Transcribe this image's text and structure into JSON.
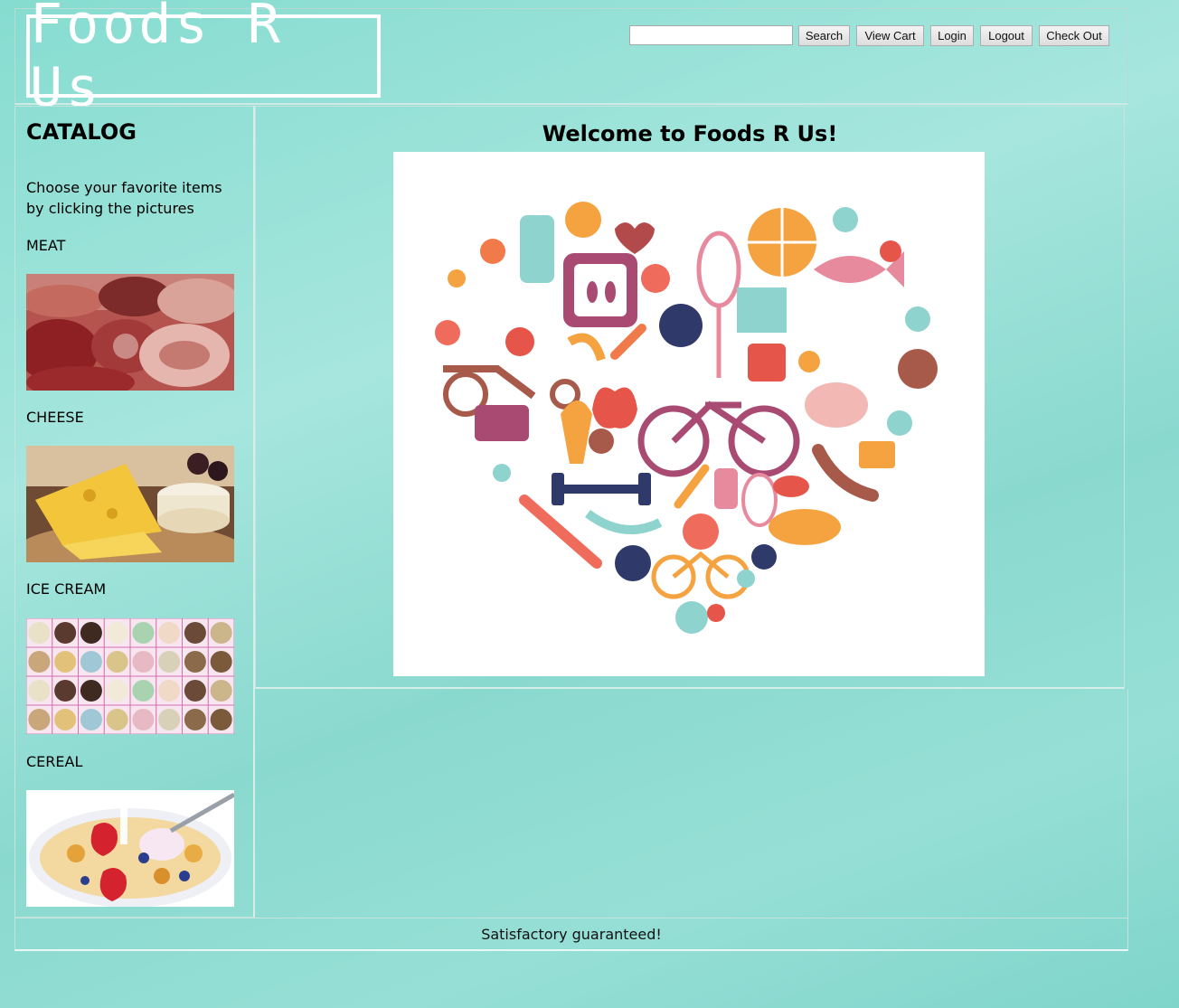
{
  "header": {
    "logo_text": "Foods R Us",
    "search": {
      "value": "",
      "placeholder": ""
    },
    "buttons": {
      "search": "Search",
      "view_cart": "View Cart",
      "login": "Login",
      "logout": "Logout",
      "check_out": "Check Out"
    }
  },
  "sidebar": {
    "title": "CATALOG",
    "intro": "Choose your favorite items by clicking the pictures",
    "categories": [
      {
        "label": "MEAT"
      },
      {
        "label": "CHEESE"
      },
      {
        "label": "ICE CREAM"
      },
      {
        "label": "CEREAL"
      }
    ]
  },
  "main": {
    "welcome": "Welcome to Foods R Us!"
  },
  "footer": {
    "text": "Satisfactory guaranteed!"
  },
  "colors": {
    "background": "#8ad9cf",
    "border": "#c5e3de"
  }
}
